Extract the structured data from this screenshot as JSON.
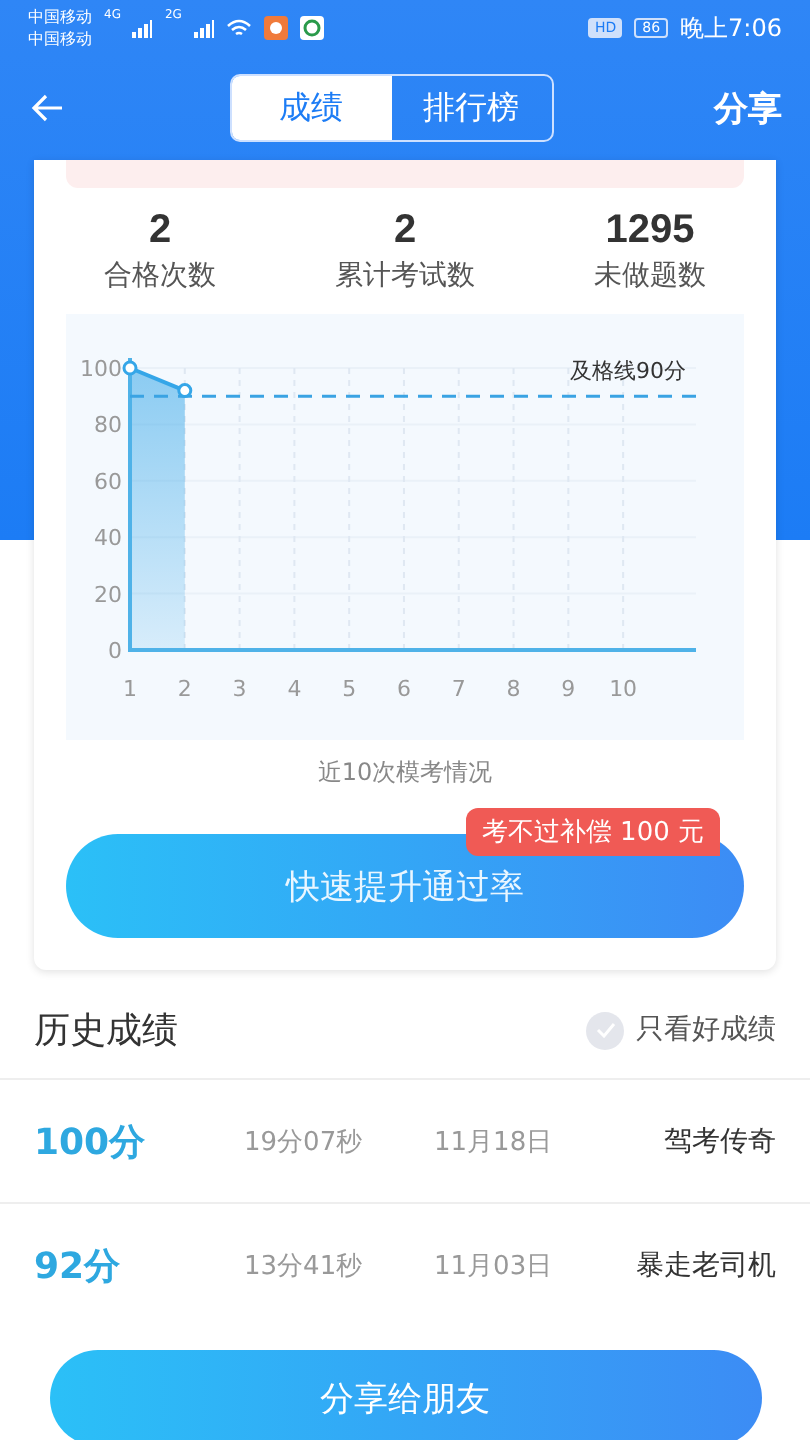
{
  "status_bar": {
    "carriers": [
      "中国移动",
      "中国移动"
    ],
    "networks": [
      "4G",
      "2G"
    ],
    "hd": "HD",
    "battery": "86",
    "time": "晚上7:06"
  },
  "nav": {
    "tabs": [
      {
        "label": "成绩",
        "selected": true
      },
      {
        "label": "排行榜",
        "selected": false
      }
    ],
    "share": "分享"
  },
  "stats": [
    {
      "value": "2",
      "label": "合格次数"
    },
    {
      "value": "2",
      "label": "累计考试数"
    },
    {
      "value": "1295",
      "label": "未做题数"
    }
  ],
  "chart": {
    "caption": "近10次模考情况",
    "chart_data": {
      "type": "area",
      "x": [
        1,
        2
      ],
      "series": [
        {
          "color": "#35a6e8",
          "values": [
            100,
            92
          ]
        }
      ],
      "xlim": [
        1,
        11.33
      ],
      "ylim": [
        0,
        100
      ],
      "yticks": [
        0,
        20,
        40,
        60,
        80,
        100
      ],
      "xticks": [
        1,
        2,
        3,
        4,
        5,
        6,
        7,
        8,
        9,
        10
      ],
      "grid": true,
      "ref_lines": [
        {
          "axis": "y",
          "value": 90,
          "label": "及格线90分"
        }
      ]
    }
  },
  "promo": {
    "badge": "考不过补偿 100 元",
    "button": "快速提升通过率"
  },
  "history": {
    "title": "历史成绩",
    "filter": {
      "label": "只看好成绩",
      "checked": false
    },
    "rows": [
      {
        "score": "100分",
        "duration": "19分07秒",
        "date": "11月18日",
        "title": "驾考传奇"
      },
      {
        "score": "92分",
        "duration": "13分41秒",
        "date": "11月03日",
        "title": "暴走老司机"
      }
    ]
  },
  "share_button": "分享给朋友"
}
